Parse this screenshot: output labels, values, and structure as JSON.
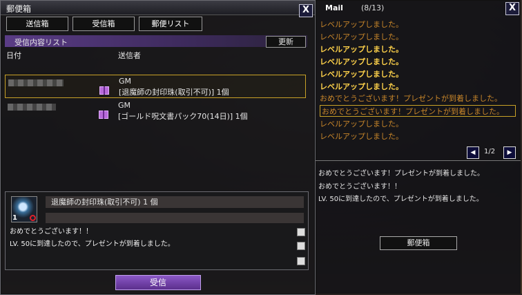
{
  "mailbox": {
    "title": "郵便箱",
    "close_label": "X",
    "tabs": [
      "送信箱",
      "受信箱",
      "郵便リスト"
    ],
    "list_title": "受信内容リスト",
    "refresh_label": "更新",
    "col_date": "日付",
    "col_sender": "送信者",
    "rows": [
      {
        "sender": "GM",
        "item": "[退魔師の封印珠(取引不可)] 1個"
      },
      {
        "sender": "GM",
        "item": "[ゴールド呪文書パック70(14日)] 1個"
      }
    ],
    "detail": {
      "item_name": "退魔師の封印珠(取引不可) 1 個",
      "qty": "1",
      "line1": "おめでとうございます！！",
      "line2": "LV. 50に到達したので、プレゼントが到着しました。"
    },
    "receive_label": "受信"
  },
  "notif": {
    "title": "Mail",
    "count": "(8/13)",
    "close_label": "X",
    "lines": [
      {
        "text": "レベルアップしました。",
        "state": "read"
      },
      {
        "text": "レベルアップしました。",
        "state": "read"
      },
      {
        "text": "レベルアップしました。",
        "state": "unread"
      },
      {
        "text": "レベルアップしました。",
        "state": "unread"
      },
      {
        "text": "レベルアップしました。",
        "state": "unread"
      },
      {
        "text": "レベルアップしました。",
        "state": "unread"
      },
      {
        "text": "おめでとうございます！プレゼントが到着しました。",
        "state": "read"
      },
      {
        "text": "おめでとうございます！プレゼントが到着しました。",
        "state": "selected"
      },
      {
        "text": "レベルアップしました。",
        "state": "read"
      },
      {
        "text": "レベルアップしました。",
        "state": "read"
      }
    ],
    "page": "1/2",
    "msg1": "おめでとうございます！プレゼントが到着しました。",
    "msg2": "おめでとうございます！！",
    "msg3": "LV. 50に到達したので、プレゼントが到着しました。",
    "mailbox_label": "郵便箱"
  }
}
